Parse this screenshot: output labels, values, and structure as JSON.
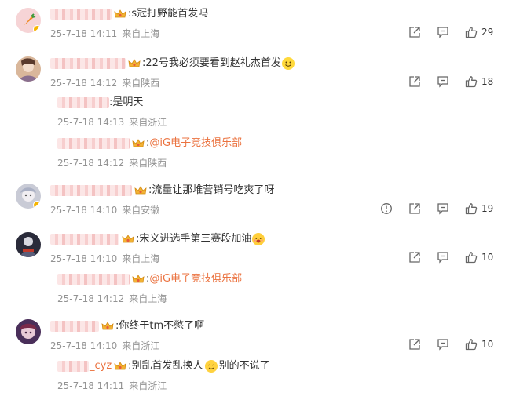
{
  "comments": [
    {
      "text": ":s冠打野能首发吗",
      "time": "25-7-18 14:11",
      "location": "来自上海",
      "likes": "29",
      "avatar_color": "#f6d4d6",
      "replies": []
    },
    {
      "text": ":22号我必须要看到赵礼杰首发",
      "time": "25-7-18 14:12",
      "location": "来自陕西",
      "likes": "18",
      "avatar_color": "#d9b79b",
      "replies": [
        {
          "text": ":是明天",
          "time": "25-7-18 14:13",
          "location": "来自浙江"
        },
        {
          "colon": ":",
          "mention": "@iG电子竞技俱乐部",
          "time": "25-7-18 14:12",
          "location": "来自陕西"
        }
      ]
    },
    {
      "text": ":流量让那堆营销号吃爽了呀",
      "time": "25-7-18 14:10",
      "location": "来自安徽",
      "likes": "19",
      "avatar_color": "#c9cbd6",
      "replies": []
    },
    {
      "text": ":宋义进选手第三赛段加油",
      "time": "25-7-18 14:10",
      "location": "来自上海",
      "likes": "10",
      "avatar_color": "#2a2b3a",
      "replies": [
        {
          "colon": ":",
          "mention": "@iG电子竞技俱乐部",
          "time": "25-7-18 14:12",
          "location": "来自上海"
        }
      ]
    },
    {
      "text": ":你终于tm不憋了啊",
      "time": "25-7-18 14:10",
      "location": "来自浙江",
      "likes": "10",
      "avatar_color": "#4a2f5a",
      "replies": [
        {
          "nick_suffix": "_cyz",
          "text": ":别乱首发乱换人",
          "text2": "别的不说了",
          "time": "25-7-18 14:11",
          "location": "来自浙江"
        }
      ]
    }
  ],
  "colors": {
    "mention": "#eb7340",
    "meta": "#939393",
    "badge": "#f7b500"
  }
}
